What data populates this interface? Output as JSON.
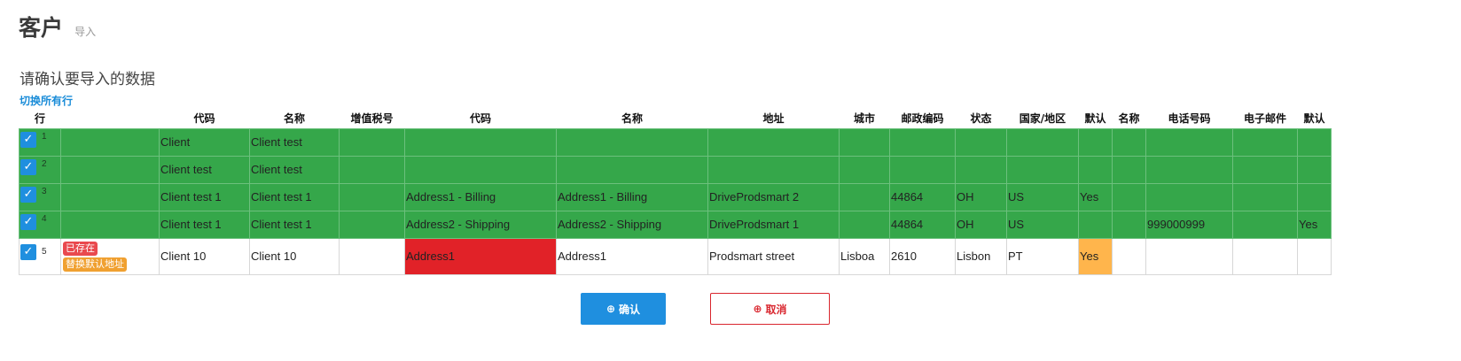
{
  "header": {
    "title": "客户",
    "subtitle": "导入"
  },
  "confirm_text": "请确认要导入的数据",
  "toggle_all": "切换所有行",
  "columns": [
    "行",
    "",
    "代码",
    "名称",
    "增值税号",
    "代码",
    "名称",
    "地址",
    "城市",
    "邮政编码",
    "状态",
    "国家/地区",
    "默认",
    "名称",
    "电话号码",
    "电子邮件",
    "默认"
  ],
  "rows": [
    {
      "num": "1",
      "status": "ok",
      "checked": true,
      "badges": [],
      "cells": [
        "Client",
        "Client test",
        "",
        "",
        "",
        "",
        "",
        "",
        "",
        "",
        "",
        "",
        "",
        "",
        ""
      ]
    },
    {
      "num": "2",
      "status": "ok",
      "checked": true,
      "badges": [],
      "cells": [
        "Client test",
        "Client test",
        "",
        "",
        "",
        "",
        "",
        "",
        "",
        "",
        "",
        "",
        "",
        "",
        ""
      ]
    },
    {
      "num": "3",
      "status": "ok",
      "checked": true,
      "badges": [],
      "cells": [
        "Client test 1",
        "Client test 1",
        "",
        "Address1 - Billing",
        "Address1 - Billing",
        "DriveProdsmart 2",
        "",
        "44864",
        "OH",
        "US",
        "Yes",
        "",
        "",
        "",
        ""
      ]
    },
    {
      "num": "4",
      "status": "ok",
      "checked": true,
      "badges": [],
      "cells": [
        "Client test 1",
        "Client test 1",
        "",
        "Address2 - Shipping",
        "Address2 - Shipping",
        "DriveProdsmart 1",
        "",
        "44864",
        "OH",
        "US",
        "",
        "",
        "999000999",
        "",
        "Yes"
      ]
    },
    {
      "num": "5",
      "status": "new",
      "checked": true,
      "badges": [
        "已存在",
        "替换默认地址"
      ],
      "cells": [
        "Client 10",
        "Client 10",
        "",
        "Address1",
        "Address1",
        "Prodsmart street",
        "Lisboa",
        "2610",
        "Lisbon",
        "PT",
        "Yes",
        "",
        "",
        "",
        ""
      ]
    }
  ],
  "highlights": {
    "error_cell": {
      "row": 4,
      "col": 3
    },
    "warning_cell": {
      "row": 4,
      "col": 10
    }
  },
  "buttons": {
    "confirm": "确认",
    "cancel": "取消"
  },
  "icons": {
    "checkbox": "check-icon",
    "confirm": "circle-plus-icon",
    "cancel": "circle-plus-icon"
  },
  "colors": {
    "accent": "#1f8fdf",
    "ok_row": "#35a74a",
    "error": "#e12228",
    "warning": "#ffb54c",
    "badge_exists": "#e9494e",
    "badge_replace": "#f0a030",
    "cancel": "#d9262e"
  }
}
